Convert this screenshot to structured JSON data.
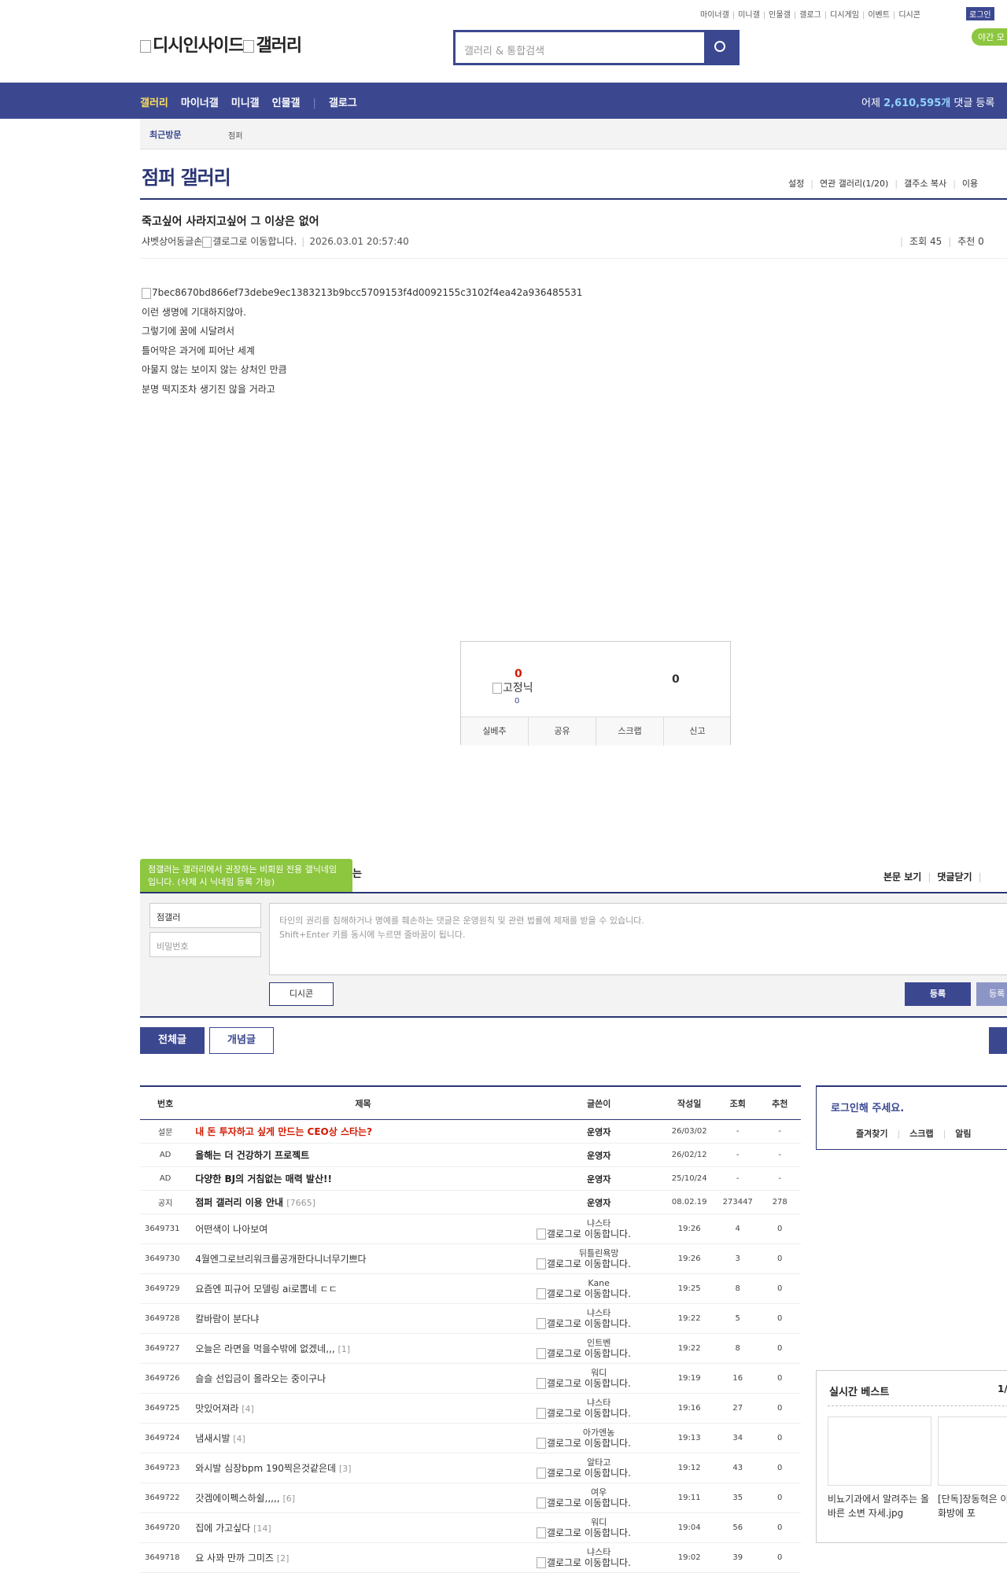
{
  "util_links": [
    "마이너갤",
    "미니갤",
    "인물갤",
    "갤로그",
    "디시게임",
    "이벤트",
    "디시콘"
  ],
  "login_label": "로그인",
  "night_label": "야간 모",
  "logo_text": "디시인사이드",
  "logo_text2": "갤러리",
  "search_placeholder": "갤러리 & 통합검색",
  "nav": {
    "items": [
      "갤러리",
      "마이너갤",
      "미니갤",
      "인물갤",
      "갤로그"
    ],
    "stat_prefix": "어제",
    "stat_value": "2,610,595개",
    "stat_suffix": "댓글 등록"
  },
  "visit": {
    "label": "최근방문",
    "gallery": "점퍼"
  },
  "gallery": {
    "title": "점퍼 갤러리",
    "menu": [
      "설정",
      "연관 갤러리(1/20)",
      "갤주소 복사",
      "이용"
    ]
  },
  "post": {
    "title": "죽고싶어 사라지고싶어 그 이상은 없어",
    "author": "샤벳상어동글손",
    "author_icon_alt": "갤로그로 이동합니다.",
    "date": "2026.03.01 20:57:40",
    "views_label": "조회 45",
    "rec_label": "추천 0",
    "image_alt": "7bec8670bd866ef73debe9ec1383213b9bcc5709153f4d0092155c3102f4ea42a936485531",
    "lines": [
      "이런 생명에 기대하지않아.",
      "그렇기에 꿈에 시달려서",
      "틀어막은 과거에 피어난 세계",
      "아물지 않는 보이지 않는 상처인 만큼",
      "분명 떡지조차 생기진 않을 거라고"
    ]
  },
  "recommend": {
    "up": "0",
    "fix_label": "고정닉",
    "fix_value": "0",
    "down": "0",
    "buttons": [
      "실베추",
      "공유",
      "스크랩",
      "신고"
    ]
  },
  "comment": {
    "tip": "점갤러는 갤러리에서 권장하는 비회원 전용 갤닉네임입니다. (삭제 시 닉네임 등록 가능)",
    "tip_tail": "는",
    "menu": [
      "본문 보기",
      "댓글닫기"
    ],
    "nick": "점갤러",
    "pw_placeholder": "비밀번호",
    "text_line1": "타인의 권리를 침해하거나 명예를 훼손하는 댓글은 운영원칙 및 관련 법률에 제재를 받을 수 있습니다.",
    "text_line2": "Shift+Enter 키를 동시에 누르면 줄바꿈이 됩니다.",
    "dccon": "디시콘",
    "register": "등록",
    "register2": "등록"
  },
  "tabs": {
    "all": "전체글",
    "best": "개념글"
  },
  "table": {
    "headers": [
      "번호",
      "제목",
      "글쓴이",
      "작성일",
      "조회",
      "추천"
    ],
    "top_rows": [
      {
        "num": "설문",
        "title": "내 돈 투자하고 싶게 만드는 CEO상 스타는?",
        "writer": "운영자",
        "date": "26/03/02",
        "views": "-",
        "rec": "-",
        "style": "red"
      },
      {
        "num": "AD",
        "title": "올해는 더 건강하기 프로젝트",
        "writer": "운영자",
        "date": "26/02/12",
        "views": "-",
        "rec": "-",
        "style": "bold"
      },
      {
        "num": "AD",
        "title": "다양한 BJ의 거침없는 매력 발산!!",
        "writer": "운영자",
        "date": "25/10/24",
        "views": "-",
        "rec": "-",
        "style": "bold"
      },
      {
        "num": "공지",
        "title": "점퍼 갤러리 이용 안내",
        "count": "[7665]",
        "writer": "운영자",
        "date": "08.02.19",
        "views": "273447",
        "rec": "278",
        "style": "bold"
      }
    ],
    "rows": [
      {
        "num": "3649731",
        "title": "어떤색이 나아보여",
        "count": "",
        "writer": "냐스타",
        "date": "19:26",
        "views": "4",
        "rec": "0"
      },
      {
        "num": "3649730",
        "title": "4월엔그로브리워크를공개한다니너무기쁘다",
        "count": "",
        "writer": "뒤틀린욕망",
        "date": "19:26",
        "views": "3",
        "rec": "0"
      },
      {
        "num": "3649729",
        "title": "요즘엔 피규어 모델링 ai로뽑네 ㄷㄷ",
        "count": "",
        "writer": "Kane",
        "date": "19:25",
        "views": "8",
        "rec": "0"
      },
      {
        "num": "3649728",
        "title": "칼바람이 분다냐",
        "count": "",
        "writer": "냐스타",
        "date": "19:22",
        "views": "5",
        "rec": "0"
      },
      {
        "num": "3649727",
        "title": "오늘은 라면을 먹을수밖에 없겠네,,,",
        "count": "[1]",
        "writer": "인트벤",
        "date": "19:22",
        "views": "8",
        "rec": "0"
      },
      {
        "num": "3649726",
        "title": "슬슬 선입금이 올라오는 중이구나",
        "count": "",
        "writer": "워디",
        "date": "19:19",
        "views": "16",
        "rec": "0"
      },
      {
        "num": "3649725",
        "title": "맛있어져라",
        "count": "[4]",
        "writer": "냐스타",
        "date": "19:16",
        "views": "27",
        "rec": "0"
      },
      {
        "num": "3649724",
        "title": "냄새시발",
        "count": "[4]",
        "writer": "아가엔농",
        "date": "19:13",
        "views": "34",
        "rec": "0"
      },
      {
        "num": "3649723",
        "title": "와시발 심장bpm 190찍은것같은데",
        "count": "[3]",
        "writer": "알타고",
        "date": "19:12",
        "views": "43",
        "rec": "0"
      },
      {
        "num": "3649722",
        "title": "갓겜에이펙스하쉴,,,,,",
        "count": "[6]",
        "writer": "여우",
        "date": "19:11",
        "views": "35",
        "rec": "0"
      },
      {
        "num": "3649720",
        "title": "집에 가고싶다",
        "count": "[14]",
        "writer": "워디",
        "date": "19:04",
        "views": "56",
        "rec": "0"
      },
      {
        "num": "3649718",
        "title": "요 사꽈 만까 그미즈",
        "count": "[2]",
        "writer": "냐스타",
        "date": "19:02",
        "views": "39",
        "rec": "0"
      }
    ],
    "writer_icon_alt": "갤로그로 이동합니다."
  },
  "sidebar": {
    "login_title": "로그인해 주세요.",
    "login_links": [
      "즐겨찾기",
      "스크랩",
      "알림"
    ],
    "best_title": "실시간 베스트",
    "best_page": "1/",
    "best_items": [
      "비뇨기과에서 알려주는 올바른 소변 자세.jpg",
      "[단독]장동혁은 이 단체대화방에 포"
    ]
  }
}
